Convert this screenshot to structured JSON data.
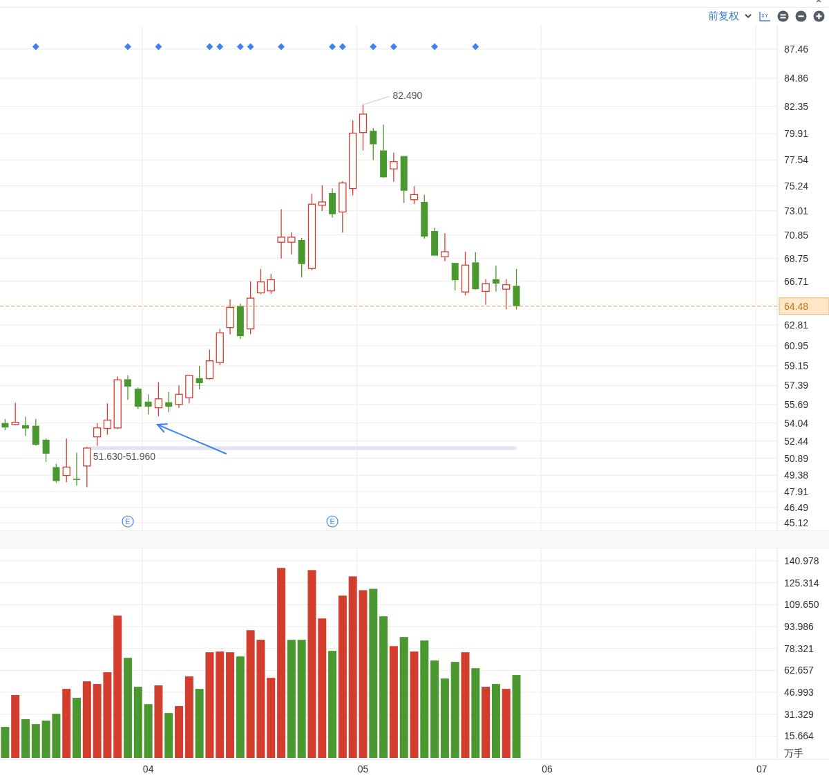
{
  "toolbar": {
    "adjust_label": "前复权"
  },
  "price_chart": {
    "chart_data": {
      "type": "candlestick",
      "grid": true,
      "ylim": [
        44.44,
        89.56
      ],
      "yticks": [
        87.46,
        84.86,
        82.35,
        79.91,
        77.54,
        75.24,
        73.01,
        70.85,
        68.75,
        66.71,
        62.81,
        60.95,
        59.15,
        57.39,
        55.69,
        54.04,
        52.44,
        50.89,
        49.38,
        47.91,
        46.49,
        45.12
      ],
      "categories": [
        null,
        null,
        null,
        null,
        null,
        null,
        null,
        null,
        null,
        null,
        null,
        null,
        null,
        null,
        null,
        null,
        null,
        null,
        null,
        null,
        null,
        null,
        null,
        null,
        null,
        null,
        null,
        null,
        null,
        null,
        null,
        null,
        null,
        null,
        null,
        null,
        null,
        null,
        null,
        null,
        null,
        null,
        null,
        null,
        null,
        null,
        null,
        null,
        null,
        null,
        null,
        null,
        null,
        null,
        null,
        null,
        null,
        null,
        null,
        null,
        null,
        null,
        null,
        null,
        null,
        null,
        null,
        null,
        null,
        null,
        null,
        null,
        null,
        null,
        null,
        null
      ],
      "ohlc": [
        [
          54.04,
          54.4,
          53.4,
          53.64
        ],
        [
          53.9,
          55.85,
          53.85,
          54.1
        ],
        [
          53.85,
          54.6,
          52.9,
          53.55
        ],
        [
          53.8,
          54.4,
          52.05,
          52.1
        ],
        [
          52.55,
          52.65,
          50.55,
          51.3
        ],
        [
          50.1,
          50.4,
          48.7,
          48.85
        ],
        [
          49.35,
          52.65,
          48.75,
          50.1
        ],
        [
          49.05,
          51.4,
          48.45,
          48.95
        ],
        [
          50.2,
          51.9,
          48.3,
          51.8
        ],
        [
          52.8,
          54.04,
          52.0,
          53.6
        ],
        [
          53.55,
          55.8,
          53.0,
          54.3
        ],
        [
          53.6,
          58.2,
          53.5,
          57.9
        ],
        [
          57.95,
          58.3,
          56.1,
          57.3
        ],
        [
          57.1,
          57.2,
          55.3,
          55.5
        ],
        [
          55.95,
          56.6,
          54.8,
          55.5
        ],
        [
          55.4,
          57.7,
          54.65,
          56.2
        ],
        [
          55.9,
          56.8,
          55.0,
          55.5
        ],
        [
          55.7,
          57.4,
          55.4,
          56.6
        ],
        [
          56.3,
          58.35,
          55.8,
          58.3
        ],
        [
          58.05,
          59.15,
          57.05,
          57.6
        ],
        [
          58.0,
          60.6,
          57.95,
          59.6
        ],
        [
          59.45,
          62.45,
          59.2,
          62.1
        ],
        [
          62.57,
          65.08,
          61.97,
          64.38
        ],
        [
          64.5,
          64.7,
          61.55,
          61.8
        ],
        [
          62.45,
          66.71,
          62.0,
          65.2
        ],
        [
          65.67,
          67.8,
          65.55,
          66.65
        ],
        [
          65.85,
          67.35,
          65.6,
          66.85
        ],
        [
          70.2,
          73.15,
          68.75,
          70.65
        ],
        [
          70.2,
          71.1,
          69.1,
          70.65
        ],
        [
          70.4,
          70.6,
          67.05,
          68.25
        ],
        [
          67.85,
          74.55,
          67.7,
          73.6
        ],
        [
          73.5,
          75.3,
          73.0,
          73.8
        ],
        [
          74.6,
          75.0,
          72.4,
          72.7
        ],
        [
          72.9,
          75.65,
          71.05,
          75.5
        ],
        [
          75.0,
          81.1,
          74.4,
          79.95
        ],
        [
          80.0,
          82.49,
          78.4,
          81.65
        ],
        [
          80.15,
          80.4,
          77.54,
          78.95
        ],
        [
          78.4,
          80.7,
          75.95,
          76.0
        ],
        [
          76.75,
          78.2,
          75.6,
          77.4
        ],
        [
          77.9,
          77.9,
          73.7,
          74.8
        ],
        [
          74.0,
          75.2,
          73.6,
          74.45
        ],
        [
          73.8,
          74.45,
          70.5,
          70.7
        ],
        [
          71.2,
          71.5,
          68.95,
          69.0
        ],
        [
          68.9,
          71.0,
          68.5,
          69.35
        ],
        [
          68.35,
          68.35,
          65.9,
          66.8
        ],
        [
          65.75,
          69.35,
          65.45,
          68.15
        ],
        [
          68.4,
          69.3,
          65.95,
          66.0
        ],
        [
          65.8,
          66.9,
          64.6,
          66.5
        ],
        [
          66.9,
          68.1,
          65.8,
          66.5
        ],
        [
          66.0,
          66.9,
          64.2,
          66.4
        ],
        [
          66.3,
          67.8,
          64.2,
          64.48
        ],
        null,
        null,
        null,
        null,
        null,
        null,
        null,
        null,
        null,
        null,
        null,
        null,
        null,
        null,
        null,
        null,
        null,
        null,
        null,
        null,
        null,
        null,
        null,
        null,
        null
      ],
      "annotations": [
        "82.490",
        "E",
        "E"
      ],
      "ref_lines": [
        {
          "axis": "y",
          "value": 64.48,
          "label": "64.48"
        }
      ],
      "bands": [
        {
          "axis": "y",
          "from": 51.63,
          "to": 51.96,
          "label": "51.630-51.960"
        }
      ]
    }
  },
  "volume_chart": {
    "chart_data": {
      "type": "bar",
      "stacked": true,
      "grid": true,
      "ylabel": "万手",
      "ylim": [
        -1,
        149.9
      ],
      "categories": [
        null,
        null,
        null,
        null,
        null,
        null,
        null,
        null,
        null,
        null,
        null,
        null,
        null,
        null,
        "04",
        null,
        null,
        null,
        null,
        null,
        null,
        null,
        null,
        null,
        null,
        null,
        null,
        null,
        null,
        null,
        null,
        null,
        null,
        null,
        null,
        "05",
        null,
        null,
        null,
        null,
        null,
        null,
        null,
        null,
        null,
        null,
        null,
        null,
        null,
        null,
        null,
        null,
        null,
        "06",
        null,
        null,
        null,
        null,
        null,
        null,
        null,
        null,
        null,
        null,
        null,
        null,
        null,
        null,
        null,
        null,
        null,
        null,
        null,
        null,
        "07",
        null
      ],
      "yticks": [
        {
          "value": 140.978,
          "label": "140.978"
        },
        {
          "value": 125.314,
          "label": "125.314"
        },
        {
          "value": 109.65,
          "label": "109.650"
        },
        {
          "value": 93.986,
          "label": "93.986"
        },
        {
          "value": 78.321,
          "label": "78.321"
        },
        {
          "value": 62.657,
          "label": "62.657"
        },
        {
          "value": 46.993,
          "label": "46.993"
        },
        {
          "value": 31.329,
          "label": "31.329"
        },
        {
          "value": 15.664,
          "label": "15.664"
        }
      ],
      "series": [
        {
          "color": "#d23d2e",
          "values": [
            null,
            45.0,
            null,
            null,
            null,
            null,
            49.4,
            null,
            54.8,
            52.9,
            61.3,
            101.8,
            null,
            null,
            null,
            51.9,
            null,
            37.1,
            58.3,
            null,
            75.6,
            76.1,
            75.6,
            null,
            91.4,
            84.5,
            57.3,
            135.9,
            null,
            null,
            134.4,
            99.8,
            null,
            116.1,
            129.9,
            120.0,
            null,
            null,
            80.0,
            null,
            76.1,
            null,
            null,
            null,
            null,
            75.6,
            null,
            50.9,
            null,
            49.4,
            null,
            null,
            null,
            null,
            null,
            null,
            null,
            null,
            null,
            null,
            null,
            null,
            null,
            null,
            null,
            null,
            null,
            null,
            null,
            null,
            null,
            null,
            null,
            null,
            null,
            null
          ]
        },
        {
          "color": "#4a982f",
          "values": [
            22.2,
            null,
            27.7,
            24.2,
            26.7,
            31.6,
            null,
            43.0,
            null,
            null,
            null,
            null,
            71.6,
            50.9,
            38.5,
            null,
            32.1,
            null,
            null,
            49.4,
            null,
            null,
            null,
            72.6,
            null,
            null,
            null,
            null,
            84.5,
            84.5,
            null,
            null,
            76.6,
            null,
            null,
            null,
            121.0,
            101.3,
            null,
            86.5,
            null,
            84.0,
            69.7,
            56.8,
            68.7,
            null,
            64.2,
            null,
            52.9,
            null,
            59.3,
            null,
            null,
            null,
            null,
            null,
            null,
            null,
            null,
            null,
            null,
            null,
            null,
            null,
            null,
            null,
            null,
            null,
            null,
            null,
            null,
            null,
            null,
            null,
            null,
            null
          ]
        }
      ]
    }
  }
}
